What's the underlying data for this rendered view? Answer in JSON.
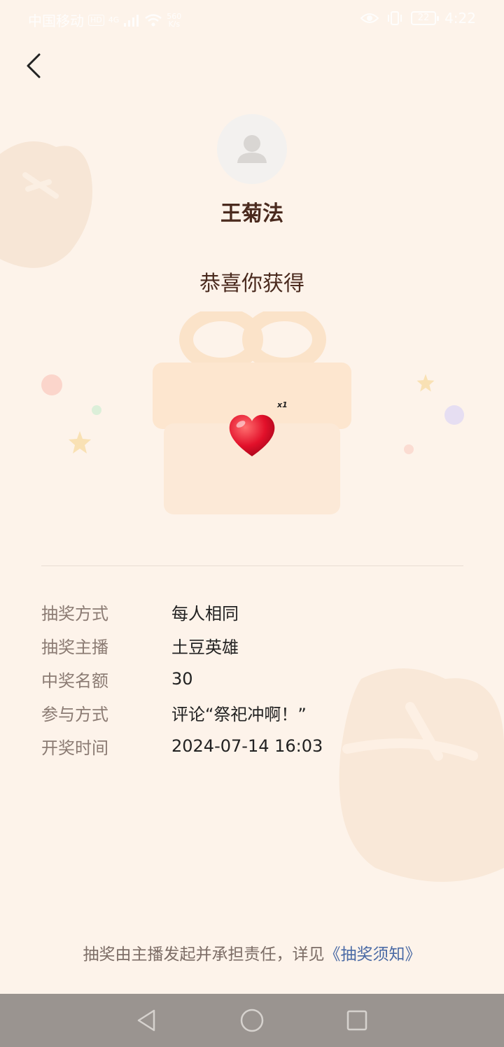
{
  "status_bar": {
    "carrier": "中国移动",
    "hd_badge": "HD",
    "network": "4G",
    "speed_value": "560",
    "speed_unit": "K/s",
    "battery": "22",
    "time": "4:22",
    "icons": [
      "signal-icon",
      "wifi-icon",
      "eye-icon",
      "vibrate-icon",
      "battery-icon"
    ]
  },
  "header": {
    "back_icon": "chevron-left-icon"
  },
  "winner": {
    "avatar_icon": "user-placeholder-icon",
    "name": "王菊法"
  },
  "prize": {
    "headline": "恭喜你获得",
    "gift_icon": "gift-box-icon",
    "item_icon": "heart-icon",
    "quantity": "x1"
  },
  "details": [
    {
      "label": "抽奖方式",
      "value": "每人相同"
    },
    {
      "label": "抽奖主播",
      "value": "土豆英雄"
    },
    {
      "label": "中奖名额",
      "value": "30"
    },
    {
      "label": "参与方式",
      "value": "评论“祭祀冲啊！”"
    },
    {
      "label": "开奖时间",
      "value": "2024-07-14 16:03"
    }
  ],
  "footer": {
    "notice": "抽奖由主播发起并承担责任，详见",
    "link": "《抽奖须知》"
  },
  "colors": {
    "background": "#fdf3ea",
    "title_text": "#4a2a1e",
    "label_text": "#8b7b73",
    "link": "#4a6aa5",
    "nav_bar": "#9a9490"
  },
  "nav_bar": [
    "back-triangle-icon",
    "home-circle-icon",
    "recents-square-icon"
  ]
}
